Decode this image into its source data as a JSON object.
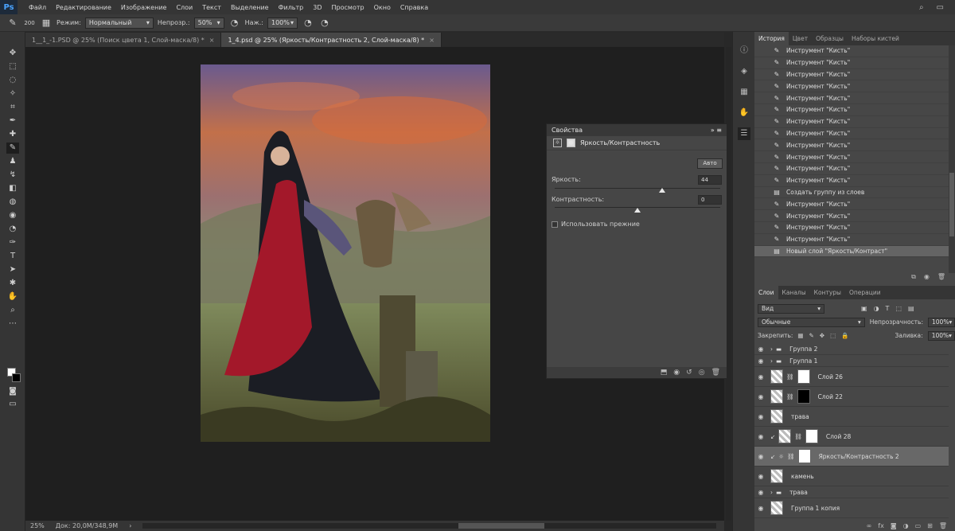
{
  "app": {
    "logo": "Ps"
  },
  "menu": [
    "Файл",
    "Редактирование",
    "Изображение",
    "Слои",
    "Текст",
    "Выделение",
    "Фильтр",
    "3D",
    "Просмотр",
    "Окно",
    "Справка"
  ],
  "options": {
    "brush_size": "200",
    "mode_label": "Режим:",
    "mode_value": "Нормальный",
    "opacity_label": "Непрозр.:",
    "opacity_value": "50%",
    "flow_label": "Наж.:",
    "flow_value": "100%"
  },
  "tabs": [
    {
      "label": "1__1_-1.PSD @ 25% (Поиск цвета 1, Слой-маска/8) *",
      "active": false
    },
    {
      "label": "1_4.psd @ 25% (Яркость/Контрастность 2, Слой-маска/8) *",
      "active": true
    }
  ],
  "status": {
    "zoom": "25%",
    "doc": "Док: 20,0M/348,9M"
  },
  "properties": {
    "title": "Свойства",
    "type_label": "Яркость/Контрастность",
    "auto_label": "Авто",
    "brightness_label": "Яркость:",
    "brightness_value": "44",
    "brightness_pct": 0.65,
    "contrast_label": "Контрастность:",
    "contrast_value": "0",
    "contrast_pct": 0.5,
    "legacy_label": "Использовать прежние"
  },
  "panel_tabs": [
    "История",
    "Цвет",
    "Образцы",
    "Наборы кистей"
  ],
  "history": [
    {
      "icon": "brush-icon",
      "label": "Инструмент \"Кисть\""
    },
    {
      "icon": "brush-icon",
      "label": "Инструмент \"Кисть\""
    },
    {
      "icon": "brush-icon",
      "label": "Инструмент \"Кисть\""
    },
    {
      "icon": "brush-icon",
      "label": "Инструмент \"Кисть\""
    },
    {
      "icon": "brush-icon",
      "label": "Инструмент \"Кисть\""
    },
    {
      "icon": "brush-icon",
      "label": "Инструмент \"Кисть\""
    },
    {
      "icon": "brush-icon",
      "label": "Инструмент \"Кисть\""
    },
    {
      "icon": "brush-icon",
      "label": "Инструмент \"Кисть\""
    },
    {
      "icon": "brush-icon",
      "label": "Инструмент \"Кисть\""
    },
    {
      "icon": "brush-icon",
      "label": "Инструмент \"Кисть\""
    },
    {
      "icon": "brush-icon",
      "label": "Инструмент \"Кисть\""
    },
    {
      "icon": "brush-icon",
      "label": "Инструмент \"Кисть\""
    },
    {
      "icon": "doc-icon",
      "label": "Создать группу из слоев"
    },
    {
      "icon": "brush-icon",
      "label": "Инструмент \"Кисть\""
    },
    {
      "icon": "brush-icon",
      "label": "Инструмент \"Кисть\""
    },
    {
      "icon": "brush-icon",
      "label": "Инструмент \"Кисть\""
    },
    {
      "icon": "brush-icon",
      "label": "Инструмент \"Кисть\""
    },
    {
      "icon": "doc-icon",
      "label": "Новый слой \"Яркость/Контраст\""
    }
  ],
  "layers_tabs": [
    "Слои",
    "Каналы",
    "Контуры",
    "Операции"
  ],
  "layers_ctrl": {
    "filter": "Вид",
    "blend": "Обычные",
    "opacity_label": "Непрозрачность:",
    "opacity": "100%",
    "lock_label": "Закрепить:",
    "fill_label": "Заливка:",
    "fill": "100%"
  },
  "layers": [
    {
      "name": "Группа 2",
      "kind": "group"
    },
    {
      "name": "Группа 1",
      "kind": "group"
    },
    {
      "name": "Слой 26",
      "kind": "mask-white"
    },
    {
      "name": "Слой 22",
      "kind": "mask-black"
    },
    {
      "name": "трава",
      "kind": "plain"
    },
    {
      "name": "Слой 28",
      "kind": "mask-white-clip"
    },
    {
      "name": "Яркость/Контрастность 2",
      "kind": "adjust",
      "selected": true
    },
    {
      "name": "камень",
      "kind": "plain"
    },
    {
      "name": "трава",
      "kind": "group"
    },
    {
      "name": "Группа 1 копия",
      "kind": "plain"
    }
  ]
}
